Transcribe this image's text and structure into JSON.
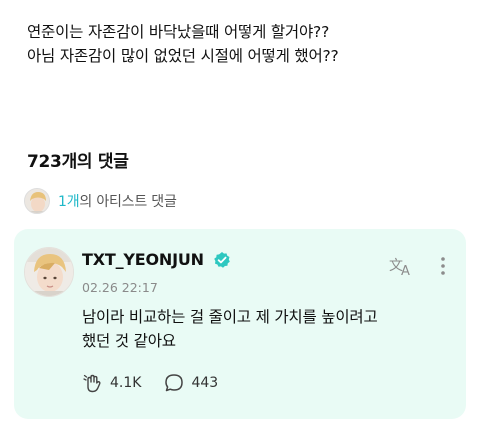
{
  "post": {
    "question_line1": "연준이는 자존감이 바닥났을때 어떻게 할거야??",
    "question_line2": "아님 자존감이 많이 없었던 시절에 어떻게 했어??"
  },
  "comments_header": {
    "title": "723개의 댓글"
  },
  "artist_summary": {
    "count": "1개",
    "label": "의 아티스트 댓글"
  },
  "comment": {
    "username": "TXT_YEONJUN",
    "date": "02.26 22:17",
    "text_line1": "남이라 비교하는 걸 줄이고 제 가치를 높이려고",
    "text_line2": "했던 것 같아요",
    "likes": "4.1K",
    "replies": "443"
  },
  "colors": {
    "accent": "#1fb8c8",
    "card_bg": "#e9fbf5",
    "verified": "#2ec8c0"
  },
  "icons": {
    "verified": "verified-badge-icon",
    "translate": "translate-icon",
    "more": "more-vertical-icon",
    "like": "heart-cheer-icon",
    "reply": "speech-bubble-icon"
  }
}
